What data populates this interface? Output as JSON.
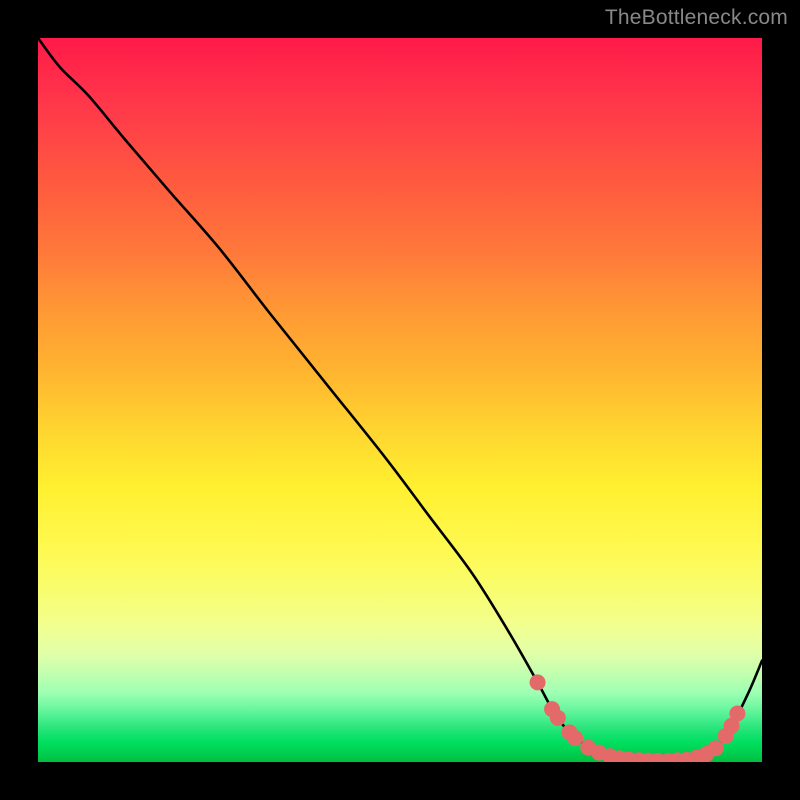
{
  "watermark": "TheBottleneck.com",
  "chart_data": {
    "type": "line",
    "title": "",
    "xlabel": "",
    "ylabel": "",
    "xlim": [
      0,
      100
    ],
    "ylim": [
      0,
      100
    ],
    "grid": false,
    "legend": false,
    "series": [
      {
        "name": "curve",
        "color": "#000000",
        "x": [
          0,
          3,
          7,
          12,
          18,
          25,
          32,
          40,
          48,
          54,
          60,
          65,
          69,
          71.5,
          74,
          77,
          80,
          83,
          86,
          89,
          92,
          95,
          98,
          100
        ],
        "values": [
          100,
          96,
          92,
          86,
          79,
          71,
          62,
          52,
          42,
          34,
          26,
          18,
          11,
          6.5,
          3.5,
          1.6,
          0.6,
          0.25,
          0.15,
          0.25,
          0.9,
          3.6,
          9.3,
          14
        ]
      }
    ],
    "markers": {
      "color": "#e46a6a",
      "radius": 8,
      "points": [
        {
          "x": 69.0,
          "y": 11.0
        },
        {
          "x": 71.0,
          "y": 7.3
        },
        {
          "x": 71.8,
          "y": 6.1
        },
        {
          "x": 73.4,
          "y": 4.1
        },
        {
          "x": 74.2,
          "y": 3.3
        },
        {
          "x": 76.0,
          "y": 2.0
        },
        {
          "x": 77.5,
          "y": 1.3
        },
        {
          "x": 79.0,
          "y": 0.8
        },
        {
          "x": 80.3,
          "y": 0.5
        },
        {
          "x": 81.6,
          "y": 0.35
        },
        {
          "x": 83.0,
          "y": 0.25
        },
        {
          "x": 84.3,
          "y": 0.18
        },
        {
          "x": 85.6,
          "y": 0.15
        },
        {
          "x": 87.0,
          "y": 0.15
        },
        {
          "x": 88.3,
          "y": 0.22
        },
        {
          "x": 89.6,
          "y": 0.3
        },
        {
          "x": 91.0,
          "y": 0.6
        },
        {
          "x": 92.3,
          "y": 1.1
        },
        {
          "x": 93.6,
          "y": 1.9
        },
        {
          "x": 95.0,
          "y": 3.6
        },
        {
          "x": 95.8,
          "y": 5.0
        },
        {
          "x": 96.6,
          "y": 6.7
        }
      ]
    }
  }
}
